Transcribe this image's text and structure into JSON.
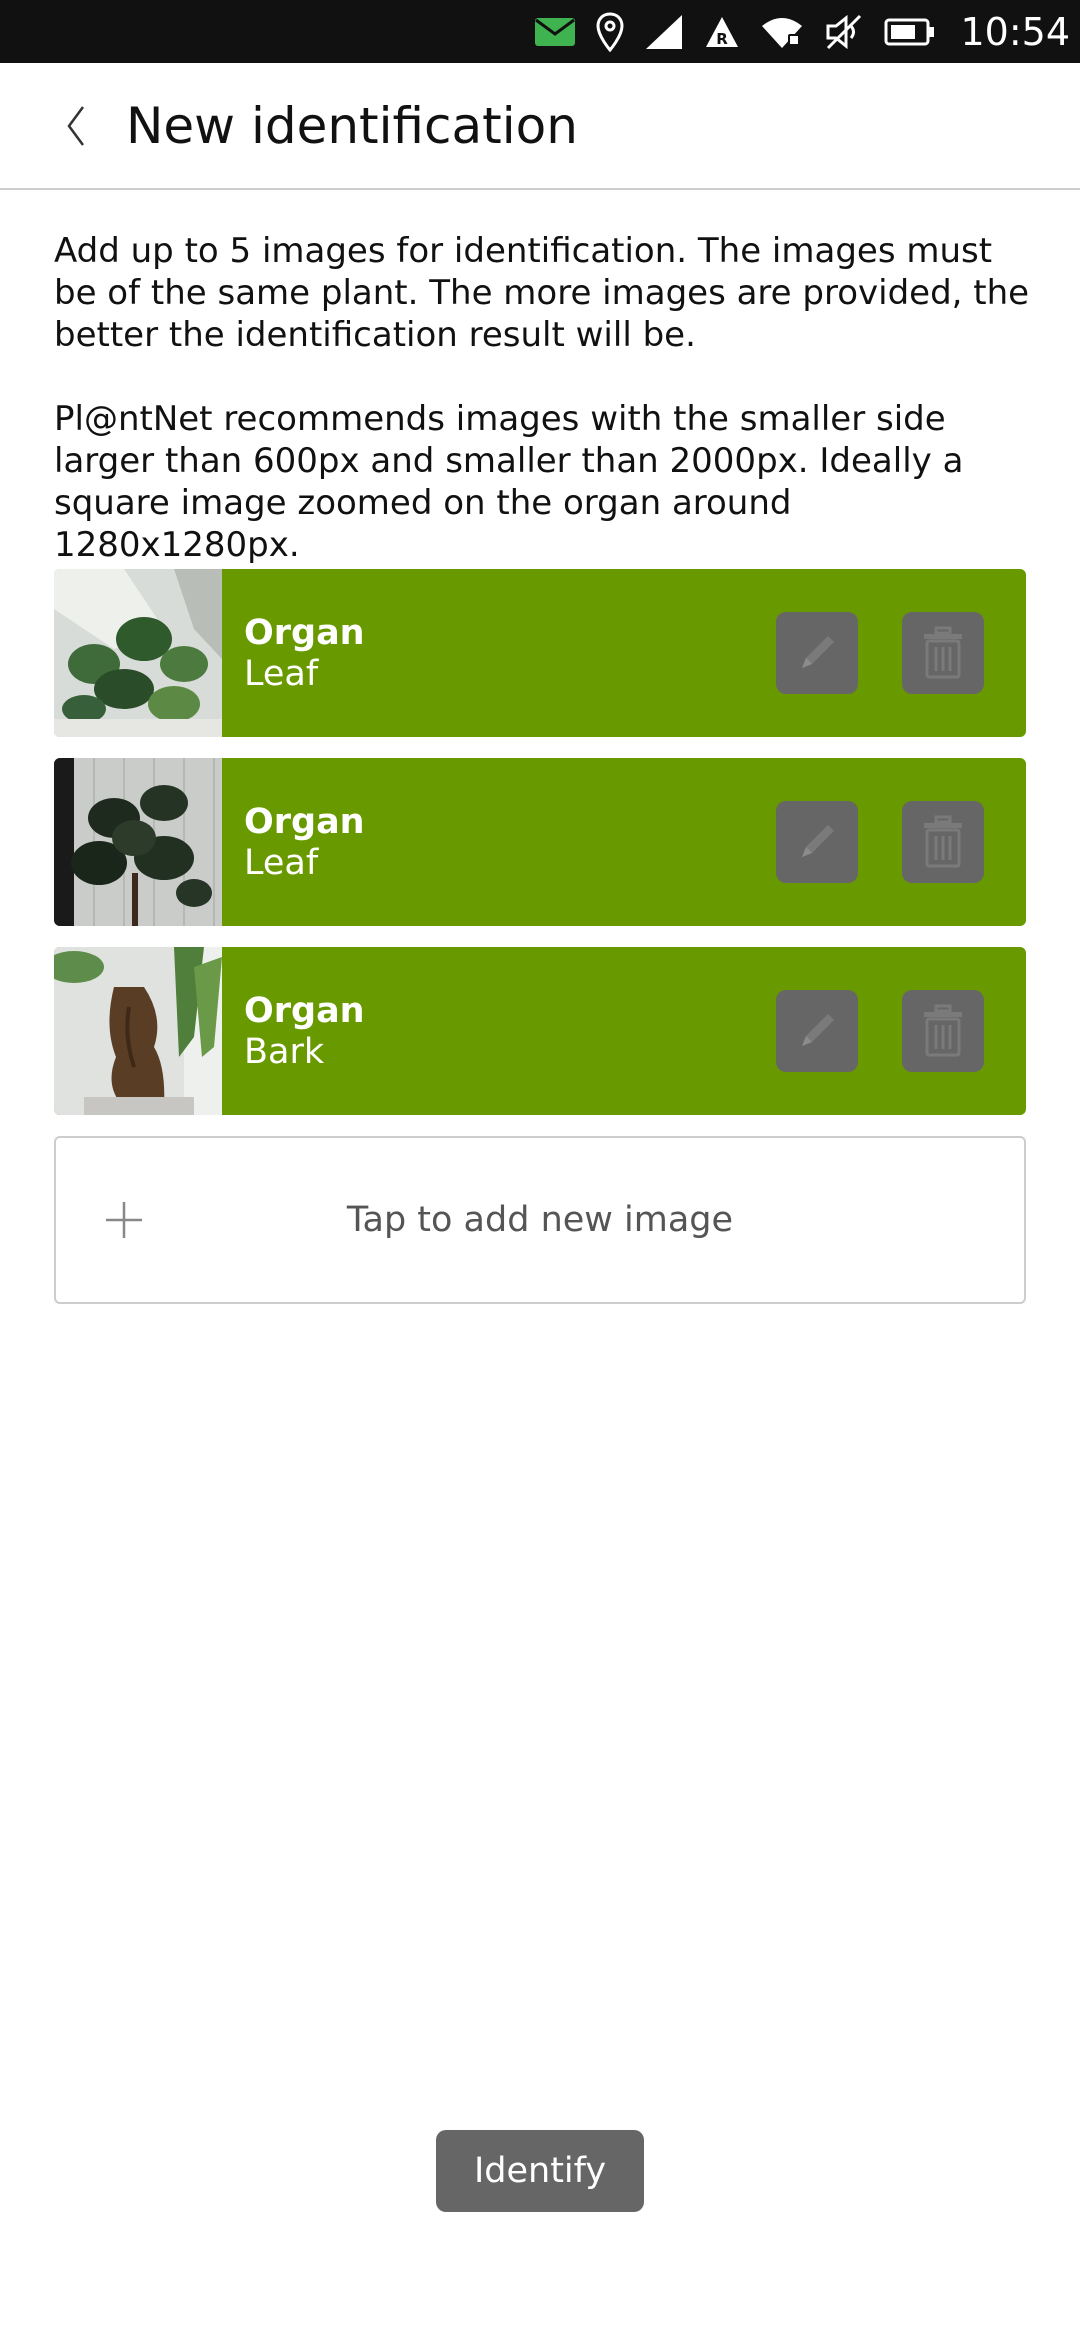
{
  "status_bar": {
    "time": "10:54",
    "icons": [
      "message-icon",
      "location-icon",
      "signal-icon",
      "roaming-icon",
      "wifi-icon",
      "muted-speaker-icon",
      "battery-icon"
    ],
    "message_color": "#3eb34f"
  },
  "header": {
    "title": "New identification",
    "back_icon": "chevron-left-icon"
  },
  "intro": {
    "paragraph1": "Add up to 5 images for identification. The images must be of the same plant. The more images are provided, the better the identification result will be.",
    "paragraph2": "Pl@ntNet recommends images with the smaller side larger than 600px and smaller than 2000px. Ideally a square image zoomed on the organ around 1280x1280px."
  },
  "images": [
    {
      "organ_label": "Organ",
      "organ_value": "Leaf",
      "thumbnail": "plant-photo"
    },
    {
      "organ_label": "Organ",
      "organ_value": "Leaf",
      "thumbnail": "plant-photo"
    },
    {
      "organ_label": "Organ",
      "organ_value": "Bark",
      "thumbnail": "plant-photo"
    }
  ],
  "row_actions": {
    "edit_icon": "pencil-icon",
    "delete_icon": "trash-icon"
  },
  "add_new": {
    "label": "Tap to add new image",
    "icon": "plus-icon"
  },
  "identify_button": {
    "label": "Identify"
  },
  "colors": {
    "row_background": "#689a00",
    "button_gray": "#666666",
    "status_bar": "#111111"
  }
}
